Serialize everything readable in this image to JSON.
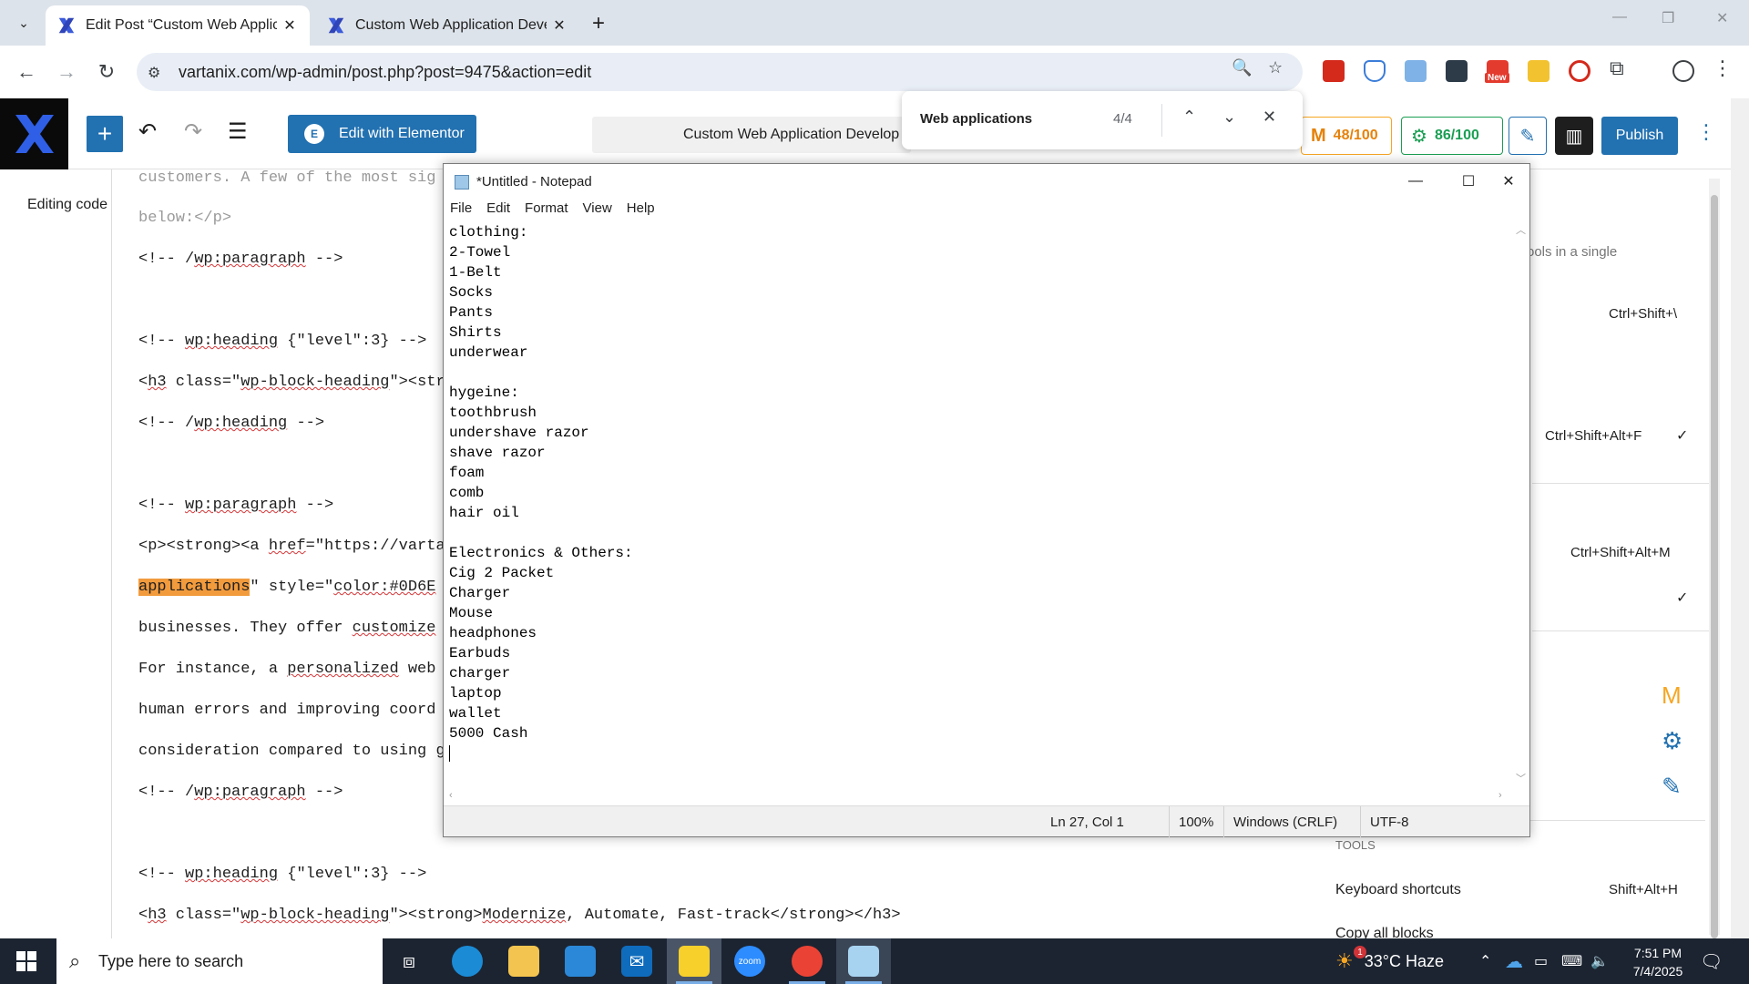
{
  "browser": {
    "tabs": [
      {
        "title": "Edit Post “Custom Web Applica",
        "active": true
      },
      {
        "title": "Custom Web Application Devel",
        "active": false
      }
    ],
    "url": "vartanix.com/wp-admin/post.php?post=9475&action=edit",
    "extension_badge": "New"
  },
  "find_bar": {
    "query": "Web applications",
    "count": "4/4"
  },
  "wp_header": {
    "edit_with_elementor": "Edit with Elementor",
    "document_title": "Custom Web Application Develop",
    "rank_score": "48/100",
    "seo_score": "86/100",
    "publish": "Publish"
  },
  "code_editor": {
    "editing_label": "Editing code",
    "lines": {
      "l1": "customers. A few of the most sig",
      "l2": "below:</p>",
      "l3a": "<!-- /",
      "l3b": "wp:paragraph",
      "l3c": " -->",
      "l4a": "<!-- ",
      "l4b": "wp:heading",
      "l4c": " {\"level\":3} -->",
      "l5a": "h3",
      "l5b": " class=\"",
      "l5c": "wp-block-heading",
      "l5d": "\"><str",
      "l6a": "<!-- /",
      "l6b": "wp:heading",
      "l6c": " -->",
      "l7a": "<!-- ",
      "l7b": "wp:paragraph",
      "l7c": " -->",
      "l8a": "<p><strong><a ",
      "l8b": "href",
      "l8c": "=\"https://varta",
      "l9a": "applications",
      "l9b": "\" style=\"",
      "l9c": "color:#0D6E",
      "l10a": "businesses. They offer ",
      "l10b": "customize",
      "l11a": "For instance, a ",
      "l11b": "personalized",
      "l11c": " web",
      "l12": "human errors and improving coord",
      "l13": "consideration compared to using g",
      "l14a": "<!-- /",
      "l14b": "wp:paragraph",
      "l14c": " -->",
      "l15a": "<!-- ",
      "l15b": "wp:heading",
      "l15c": " {\"level\":3} -->",
      "l16a": "h3",
      "l16b": " class=\"",
      "l16c": "wp-block-heading",
      "l16d": "\"><strong>",
      "l16e": "Modernize",
      "l16f": ", Automate, Fast-track</strong></h3>"
    }
  },
  "sidebar": {
    "tools_in_single": "ools in a single",
    "shortcut_1": "Ctrl+Shift+\\",
    "shortcut_2": "Ctrl+Shift+Alt+F",
    "shortcut_3": "Ctrl+Shift+Alt+M",
    "check": "✓",
    "tools_heading": "TOOLS",
    "keyboard_shortcuts": "Keyboard shortcuts",
    "keyboard_shortcuts_key": "Shift+Alt+H",
    "copy_all_blocks": "Copy all blocks"
  },
  "notepad": {
    "title": "*Untitled - Notepad",
    "menu": [
      "File",
      "Edit",
      "Format",
      "View",
      "Help"
    ],
    "content": "clothing:\n2-Towel\n1-Belt\nSocks\nPants\nShirts\nunderwear\n\nhygeine:\ntoothbrush\nundershave razor\nshave razor\nfoam\ncomb\nhair oil\n\nElectronics & Others:\nCig 2 Packet\nCharger\nMouse\nheadphones\nEarbuds\ncharger\nlaptop\nwallet\n5000 Cash\n",
    "status": {
      "position": "Ln 27, Col 1",
      "zoom": "100%",
      "line_ending": "Windows (CRLF)",
      "encoding": "UTF-8"
    }
  },
  "taskbar": {
    "search_placeholder": "Type here to search",
    "weather": "33°C  Haze",
    "weather_badge": "1",
    "time": "7:51 PM",
    "date": "7/4/2025",
    "zoom_label": "zoom"
  }
}
